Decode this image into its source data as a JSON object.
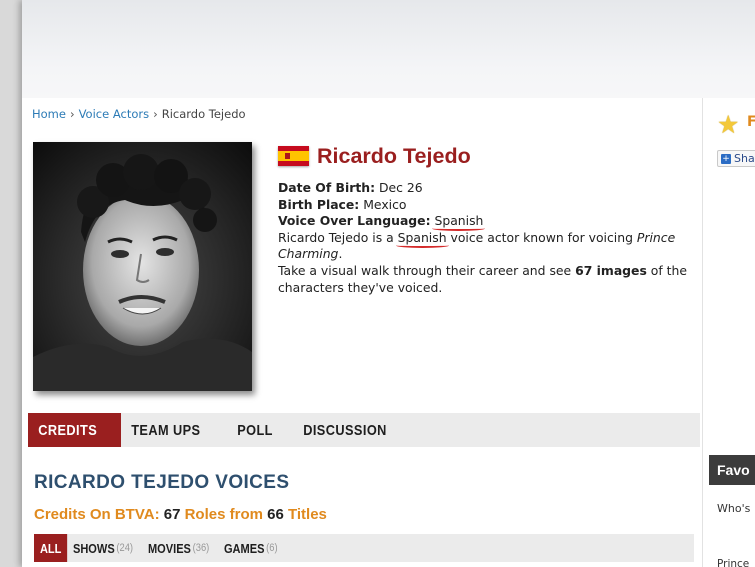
{
  "breadcrumb": {
    "home": "Home",
    "voice_actors": "Voice Actors",
    "current": "Ricardo Tejedo",
    "separator": "›"
  },
  "actor": {
    "name": "Ricardo Tejedo",
    "flag": "spain-flag",
    "dob_label": "Date Of Birth:",
    "dob_value": "Dec 26",
    "birth_place_label": "Birth Place:",
    "birth_place_value": "Mexico",
    "vo_lang_label": "Voice Over Language:",
    "vo_lang_value": "Spanish",
    "bio_prefix": "Ricardo Tejedo is a ",
    "bio_lang": "Spanish",
    "bio_mid": " voice actor known for voicing ",
    "bio_role": "Prince Charming",
    "bio_end": ".",
    "walk_prefix": "Take a visual walk through their career and see ",
    "walk_count": "67 images",
    "walk_suffix": " of the characters they've voiced."
  },
  "tabs": [
    {
      "label": "CREDITS",
      "active": true
    },
    {
      "label": "TEAM UPS",
      "active": false
    },
    {
      "label": "POLL",
      "active": false
    },
    {
      "label": "DISCUSSION",
      "active": false
    }
  ],
  "voices_title": "RICARDO TEJEDO VOICES",
  "credits": {
    "prefix": "Credits On BTVA:",
    "credits_count": "67",
    "roles_label": "Roles from",
    "roles_count": "66",
    "titles_label": "Titles"
  },
  "filters": [
    {
      "label": "ALL",
      "count": "",
      "active": true
    },
    {
      "label": "SHOWS",
      "count": "(24)",
      "active": false
    },
    {
      "label": "MOVIES",
      "count": "(36)",
      "active": false
    },
    {
      "label": "GAMES",
      "count": "(6)",
      "active": false
    }
  ],
  "sidebar": {
    "fav_letter": "F",
    "share_label": "Sha",
    "favorites_header": "Favo",
    "whos_text": "Who's",
    "prince_text": "Prince"
  },
  "colors": {
    "brand_red": "#9a1f1f",
    "accent_orange": "#e08a1e",
    "title_blue": "#2e4f6e",
    "link_blue": "#2c7bb6"
  }
}
